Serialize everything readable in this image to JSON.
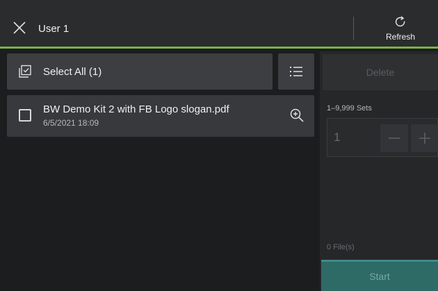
{
  "header": {
    "title": "User 1",
    "refresh_label": "Refresh"
  },
  "toolbar": {
    "select_all_label": "Select All (1)"
  },
  "files": [
    {
      "name": "BW Demo Kit 2 with FB Logo slogan.pdf",
      "date": "6/5/2021 18:09",
      "selected": false
    }
  ],
  "panel": {
    "delete_label": "Delete",
    "sets_range": "1–9,999 Sets",
    "quantity": "1",
    "file_count": "0 File(s)",
    "start_label": "Start"
  },
  "colors": {
    "accent_green": "#7cb342",
    "start_teal": "#2e6a66"
  },
  "icons": [
    "close-icon",
    "refresh-icon",
    "select-all-checkbox-icon",
    "list-view-icon",
    "checkbox-icon",
    "zoom-in-icon",
    "minus-icon",
    "plus-icon"
  ]
}
